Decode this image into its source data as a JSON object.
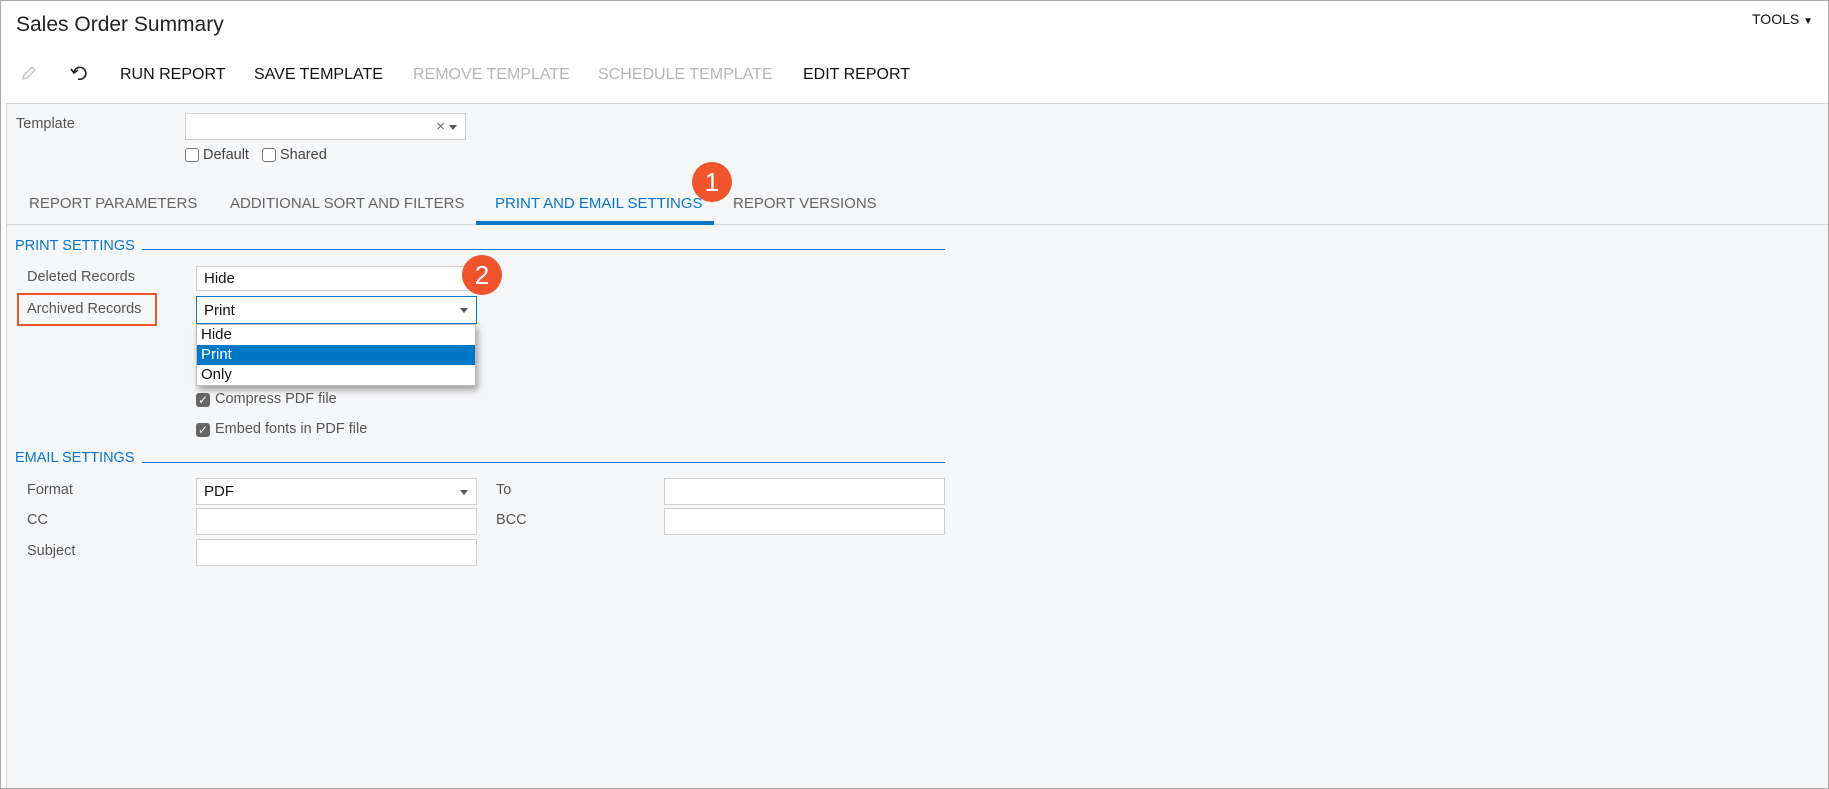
{
  "header": {
    "title": "Sales Order Summary",
    "tools_label": "TOOLS"
  },
  "toolbar": {
    "run_report": "RUN REPORT",
    "save_template": "SAVE TEMPLATE",
    "remove_template": "REMOVE TEMPLATE",
    "schedule_template": "SCHEDULE TEMPLATE",
    "edit_report": "EDIT REPORT"
  },
  "template": {
    "label": "Template",
    "value": "",
    "clear": "×",
    "default_label": "Default",
    "shared_label": "Shared"
  },
  "tabs": [
    {
      "label": "REPORT PARAMETERS"
    },
    {
      "label": "ADDITIONAL SORT AND FILTERS"
    },
    {
      "label": "PRINT AND EMAIL SETTINGS",
      "active": true
    },
    {
      "label": "REPORT VERSIONS"
    }
  ],
  "badges": {
    "one": "1",
    "two": "2"
  },
  "print_settings": {
    "title": "PRINT SETTINGS",
    "deleted_label": "Deleted Records",
    "deleted_value": "Hide",
    "archived_label": "Archived Records",
    "archived_value": "Print",
    "archived_options": [
      "Hide",
      "Print",
      "Only"
    ],
    "compress_label": "Compress PDF file",
    "compress_checked": true,
    "embed_label": "Embed fonts in PDF file",
    "embed_checked": true
  },
  "email_settings": {
    "title": "EMAIL SETTINGS",
    "format_label": "Format",
    "format_value": "PDF",
    "to_label": "To",
    "to_value": "",
    "cc_label": "CC",
    "cc_value": "",
    "bcc_label": "BCC",
    "bcc_value": "",
    "subject_label": "Subject",
    "subject_value": ""
  },
  "colors": {
    "accent": "#0a75c9",
    "badge": "#f0542d",
    "highlight": "#0078c8"
  }
}
